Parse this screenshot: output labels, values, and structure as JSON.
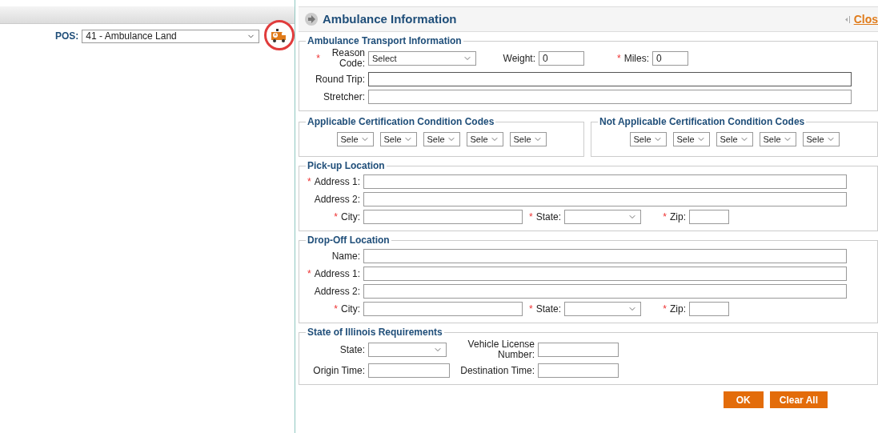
{
  "pos": {
    "label": "POS:",
    "value": "41 - Ambulance Land"
  },
  "panel": {
    "title": "Ambulance Information",
    "close": "Clos"
  },
  "transport": {
    "legend": "Ambulance Transport Information",
    "reason_code": {
      "label": "Reason Code:",
      "marker": "*",
      "value": "Select"
    },
    "weight": {
      "label": "Weight:",
      "value": "0"
    },
    "miles": {
      "label": "Miles:",
      "marker": "*",
      "value": "0"
    },
    "round_trip": {
      "label": "Round Trip:",
      "focused": true
    },
    "stretcher": {
      "label": "Stretcher:",
      "focused": false
    }
  },
  "certification": [
    {
      "legend": "Applicable Certification Condition Codes",
      "selects": [
        "Sele",
        "Sele",
        "Sele",
        "Sele",
        "Sele"
      ]
    },
    {
      "legend": "Not Applicable Certification Condition Codes",
      "selects": [
        "Sele",
        "Sele",
        "Sele",
        "Sele",
        "Sele"
      ]
    }
  ],
  "pickup": {
    "legend": "Pick-up Location",
    "rows": [
      {
        "label": "Address 1:",
        "marker": "*"
      },
      {
        "label": "Address 2:"
      }
    ],
    "city": {
      "label": "City:",
      "marker": "*"
    },
    "state": {
      "label": "State:",
      "marker": "*"
    },
    "zip": {
      "label": "Zip:",
      "marker": "*"
    }
  },
  "dropoff": {
    "legend": "Drop-Off Location",
    "rows": [
      {
        "label": "Name:"
      },
      {
        "label": "Address 1:",
        "marker": "*"
      },
      {
        "label": "Address 2:"
      }
    ],
    "city": {
      "label": "City:",
      "marker": "*"
    },
    "state": {
      "label": "State:",
      "marker": "*"
    },
    "zip": {
      "label": "Zip:",
      "marker": "*"
    }
  },
  "illinois": {
    "legend": "State of Illinois Requirements",
    "state": "State:",
    "vehicle_license": "Vehicle License Number:",
    "origin_time": "Origin Time:",
    "destination_time": "Destination Time:"
  },
  "buttons": [
    "OK",
    "Clear All"
  ]
}
